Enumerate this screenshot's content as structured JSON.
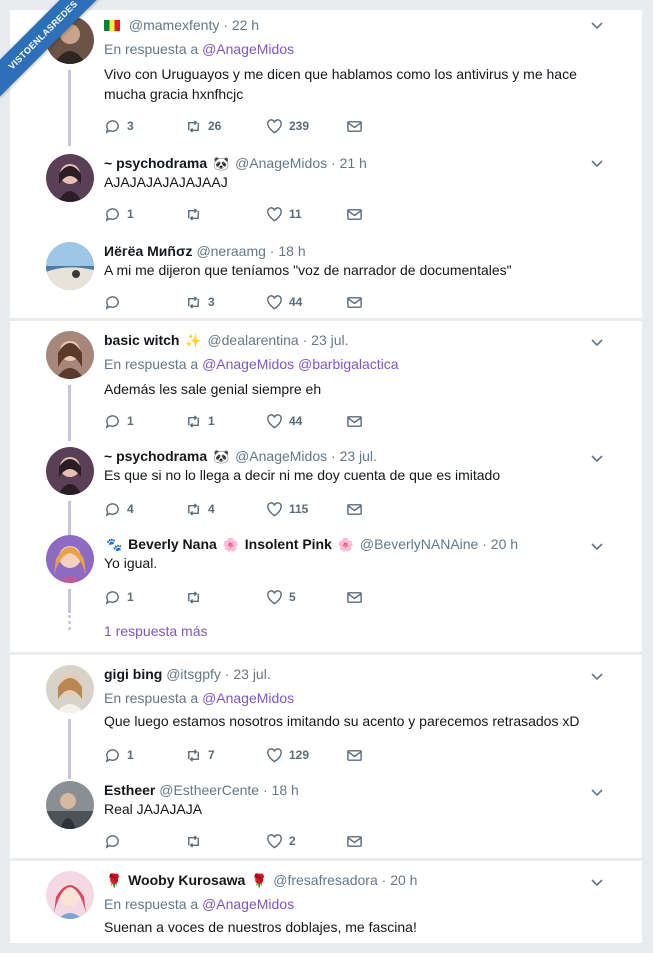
{
  "banner": "VISTOENLASREDES",
  "reply_prefix": "En respuesta a",
  "dot": "·",
  "tweets": [
    {
      "name": "",
      "flag": "flag-icon",
      "handle": "@mamexfenty",
      "time": "22 h",
      "reply_mentions": [
        "@AnageMidos"
      ],
      "text": "Vivo con Uruguayos y me dicen que hablamos como los antivirus y me hace mucha gracia hxnfhcjc",
      "replies": "3",
      "retweets": "26",
      "likes": "239"
    },
    {
      "name": "~ psychodrama",
      "emoji": "🐼",
      "handle": "@AnageMidos",
      "time": "21 h",
      "text": "AJAJAJAJAJAJAAJ",
      "replies": "1",
      "retweets": "",
      "likes": "11"
    },
    {
      "name": "Иёгёа Миñσz",
      "handle": "@neraamg",
      "time": "18 h",
      "text": "A mi me dijeron que teníamos \"voz de narrador de documentales\"",
      "replies": "",
      "retweets": "3",
      "likes": "44"
    },
    {
      "name": "basic witch",
      "emoji": "✨",
      "handle": "@dealarentina",
      "time": "23 jul.",
      "reply_mentions": [
        "@AnageMidos",
        "@barbigalactica"
      ],
      "text": "Además les sale genial siempre eh",
      "replies": "1",
      "retweets": "1",
      "likes": "44"
    },
    {
      "name": "~ psychodrama",
      "emoji": "🐼",
      "handle": "@AnageMidos",
      "time": "23 jul.",
      "text": "Es que si no lo llega a decir ni me doy cuenta de que es imitado",
      "replies": "4",
      "retweets": "4",
      "likes": "115"
    },
    {
      "name_parts": [
        "🐾",
        "Beverly Nana",
        "🌸",
        "Insolent Pink",
        "🌸"
      ],
      "handle": "@BeverlyNANAine",
      "time": "20 h",
      "text": "Yo igual.",
      "replies": "1",
      "retweets": "",
      "likes": "5"
    },
    {
      "name": "gigi bing",
      "handle": "@itsgpfy",
      "time": "23 jul.",
      "reply_mentions": [
        "@AnageMidos"
      ],
      "text": "Que luego estamos nosotros imitando su acento y parecemos retrasados xD",
      "replies": "1",
      "retweets": "7",
      "likes": "129"
    },
    {
      "name": "Estheer",
      "handle": "@EstheerCente",
      "time": "18 h",
      "text": "Real JAJAJAJA",
      "replies": "",
      "retweets": "",
      "likes": "2"
    },
    {
      "name_parts": [
        "🌹",
        "Wooby Kurosawa",
        "🌹"
      ],
      "handle": "@fresafresadora",
      "time": "20 h",
      "reply_mentions": [
        "@AnageMidos"
      ],
      "text": "Suenan a voces de nuestros doblajes, me fascina!"
    }
  ],
  "more_replies": "1 respuesta más",
  "colors": {
    "link": "#7e57c2",
    "thread": "#c9c2dc",
    "banner": "#2d6fb8",
    "muted": "#657786"
  },
  "icons": [
    "reply-icon",
    "retweet-icon",
    "like-icon",
    "message-icon",
    "chevron-down-icon"
  ]
}
